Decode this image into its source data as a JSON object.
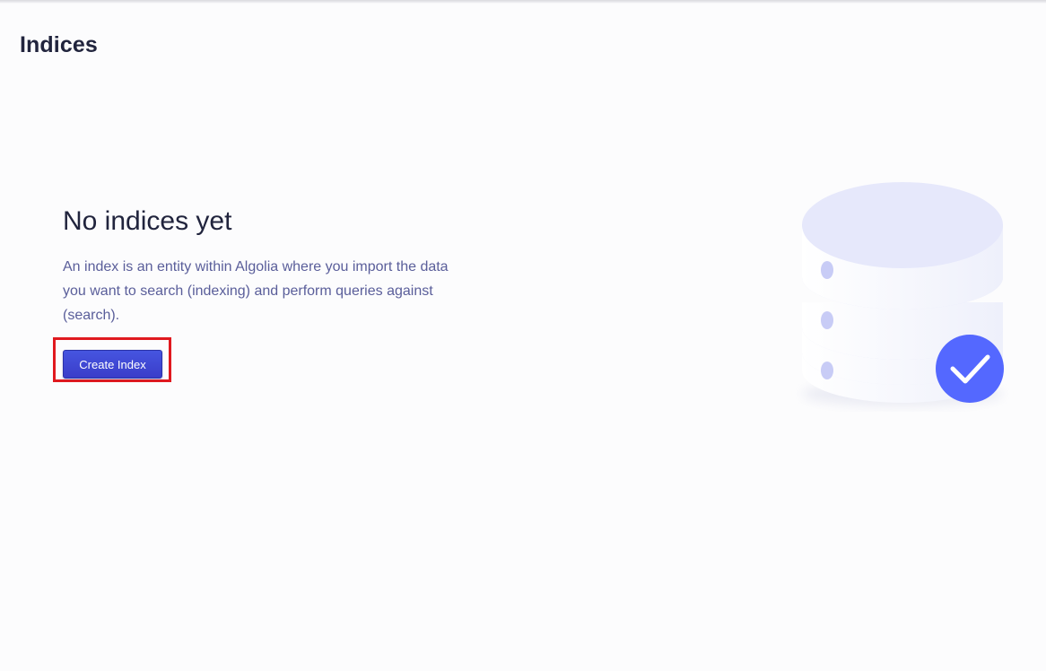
{
  "header": {
    "title": "Indices"
  },
  "empty_state": {
    "title": "No indices yet",
    "description": "An index is an entity within Algolia where you import the data you want to search (indexing) and perform queries against (search).",
    "button_label": "Create Index"
  },
  "illustration": {
    "icon": "database-check-icon",
    "colors": {
      "disk_top": "#e6e8fb",
      "disk_side": "#f5f5fb",
      "dot": "#c8ccf6",
      "badge": "#5468ff"
    }
  },
  "colors": {
    "background": "#fcfcfd",
    "title": "#21243d",
    "description": "#5a5e9a",
    "button": "#3a3dc9",
    "highlight": "#e0191f"
  }
}
